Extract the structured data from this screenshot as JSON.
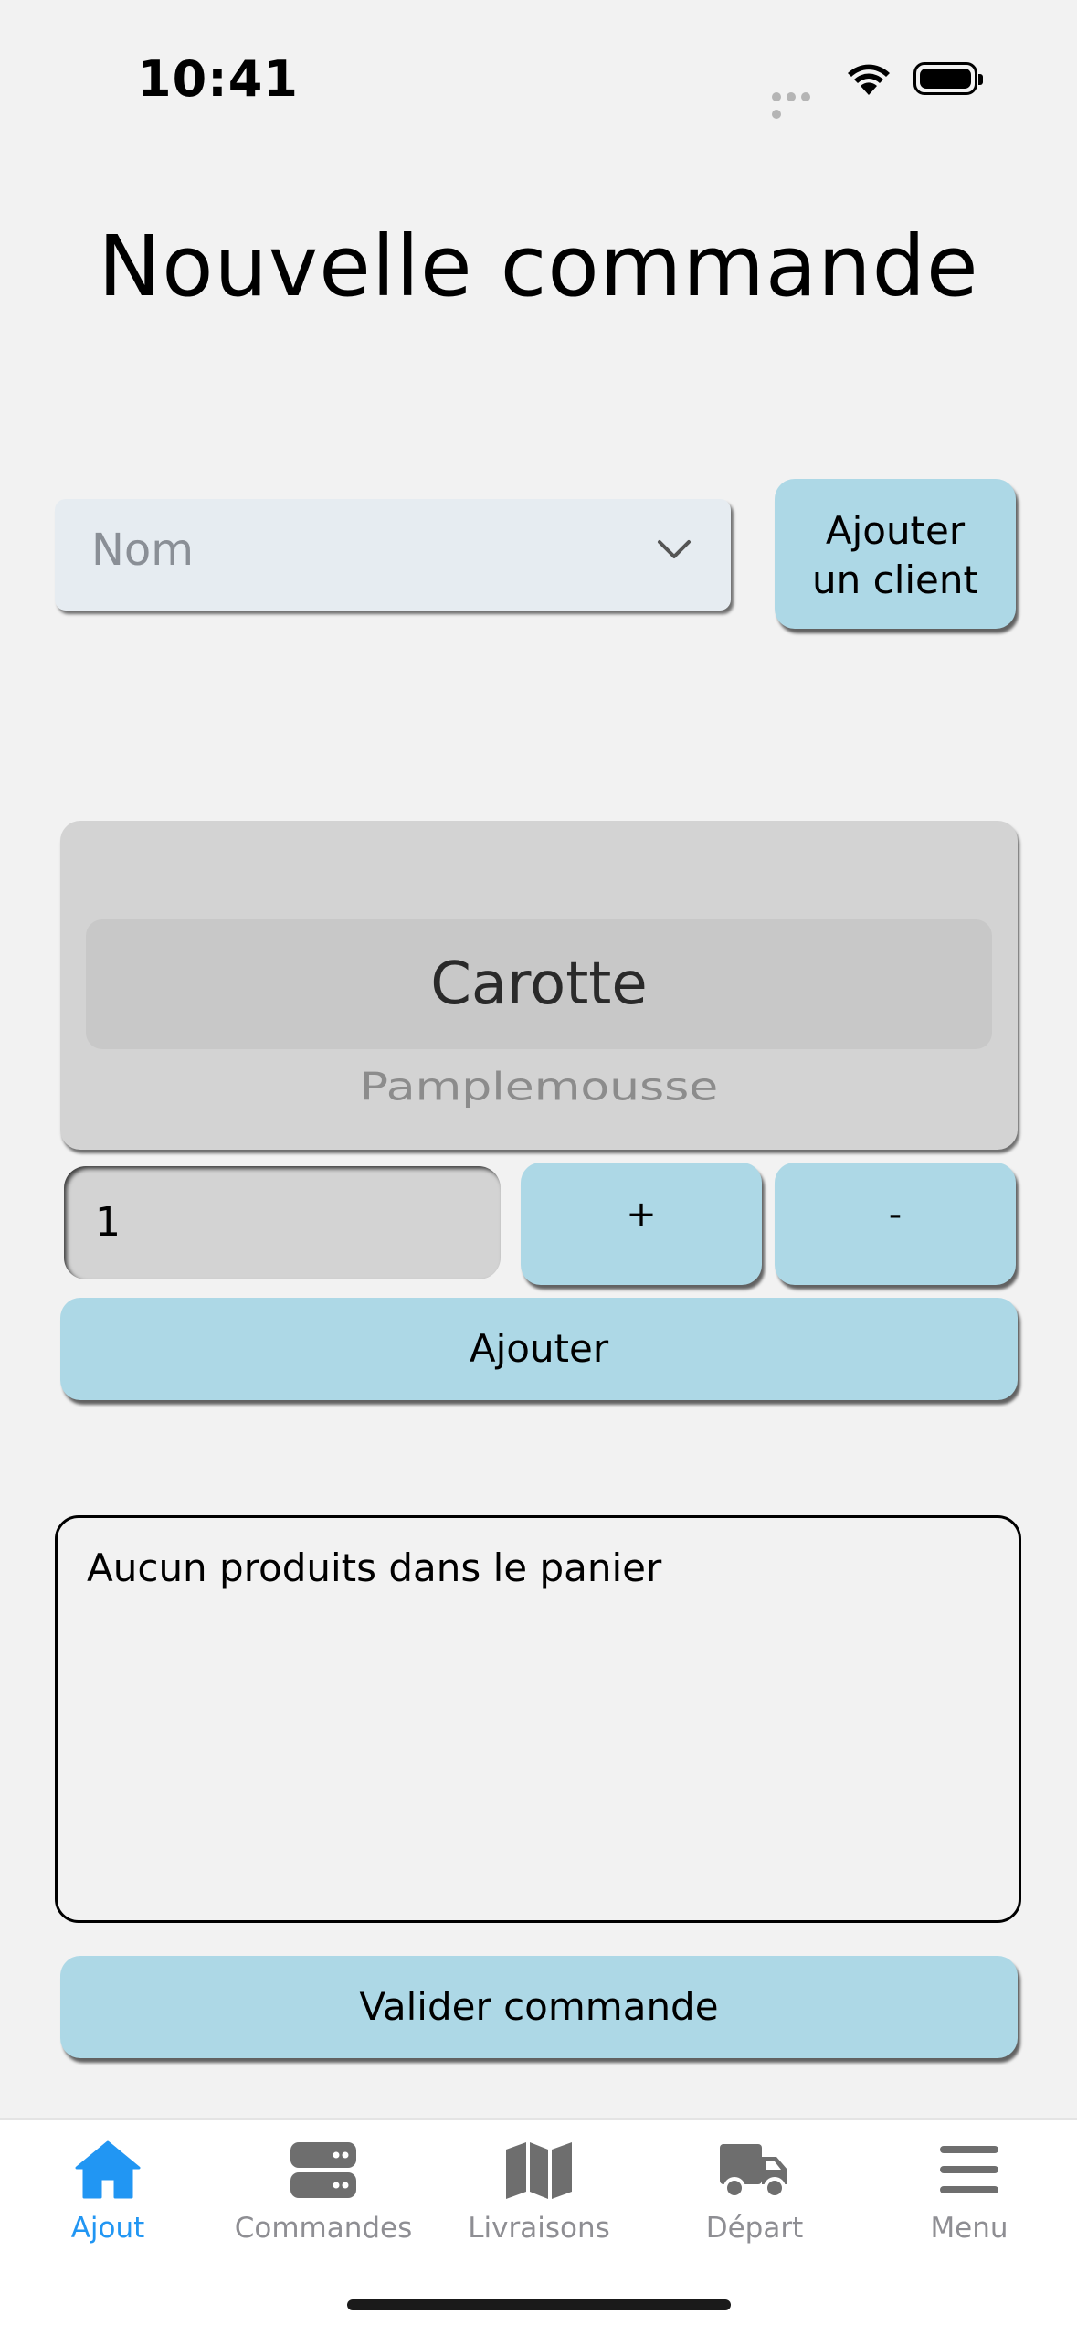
{
  "status": {
    "time": "10:41"
  },
  "page": {
    "title": "Nouvelle commande"
  },
  "client": {
    "placeholder": "Nom",
    "add_button": "Ajouter\nun client"
  },
  "picker": {
    "selected": "Carotte",
    "next": "Pamplemousse"
  },
  "quantity": {
    "value": "1",
    "plus_label": "+",
    "minus_label": "-",
    "add_label": "Ajouter"
  },
  "cart": {
    "empty_text": "Aucun produits dans le panier"
  },
  "validate_label": "Valider commande",
  "tabs": [
    {
      "label": "Ajout",
      "icon": "home-icon",
      "active": true
    },
    {
      "label": "Commandes",
      "icon": "server-icon",
      "active": false
    },
    {
      "label": "Livraisons",
      "icon": "map-icon",
      "active": false
    },
    {
      "label": "Départ",
      "icon": "truck-icon",
      "active": false
    },
    {
      "label": "Menu",
      "icon": "menu-icon",
      "active": false
    }
  ],
  "colors": {
    "accent_button": "#add8e6",
    "tab_active": "#2196f3",
    "tab_inactive": "#8e8e93"
  }
}
